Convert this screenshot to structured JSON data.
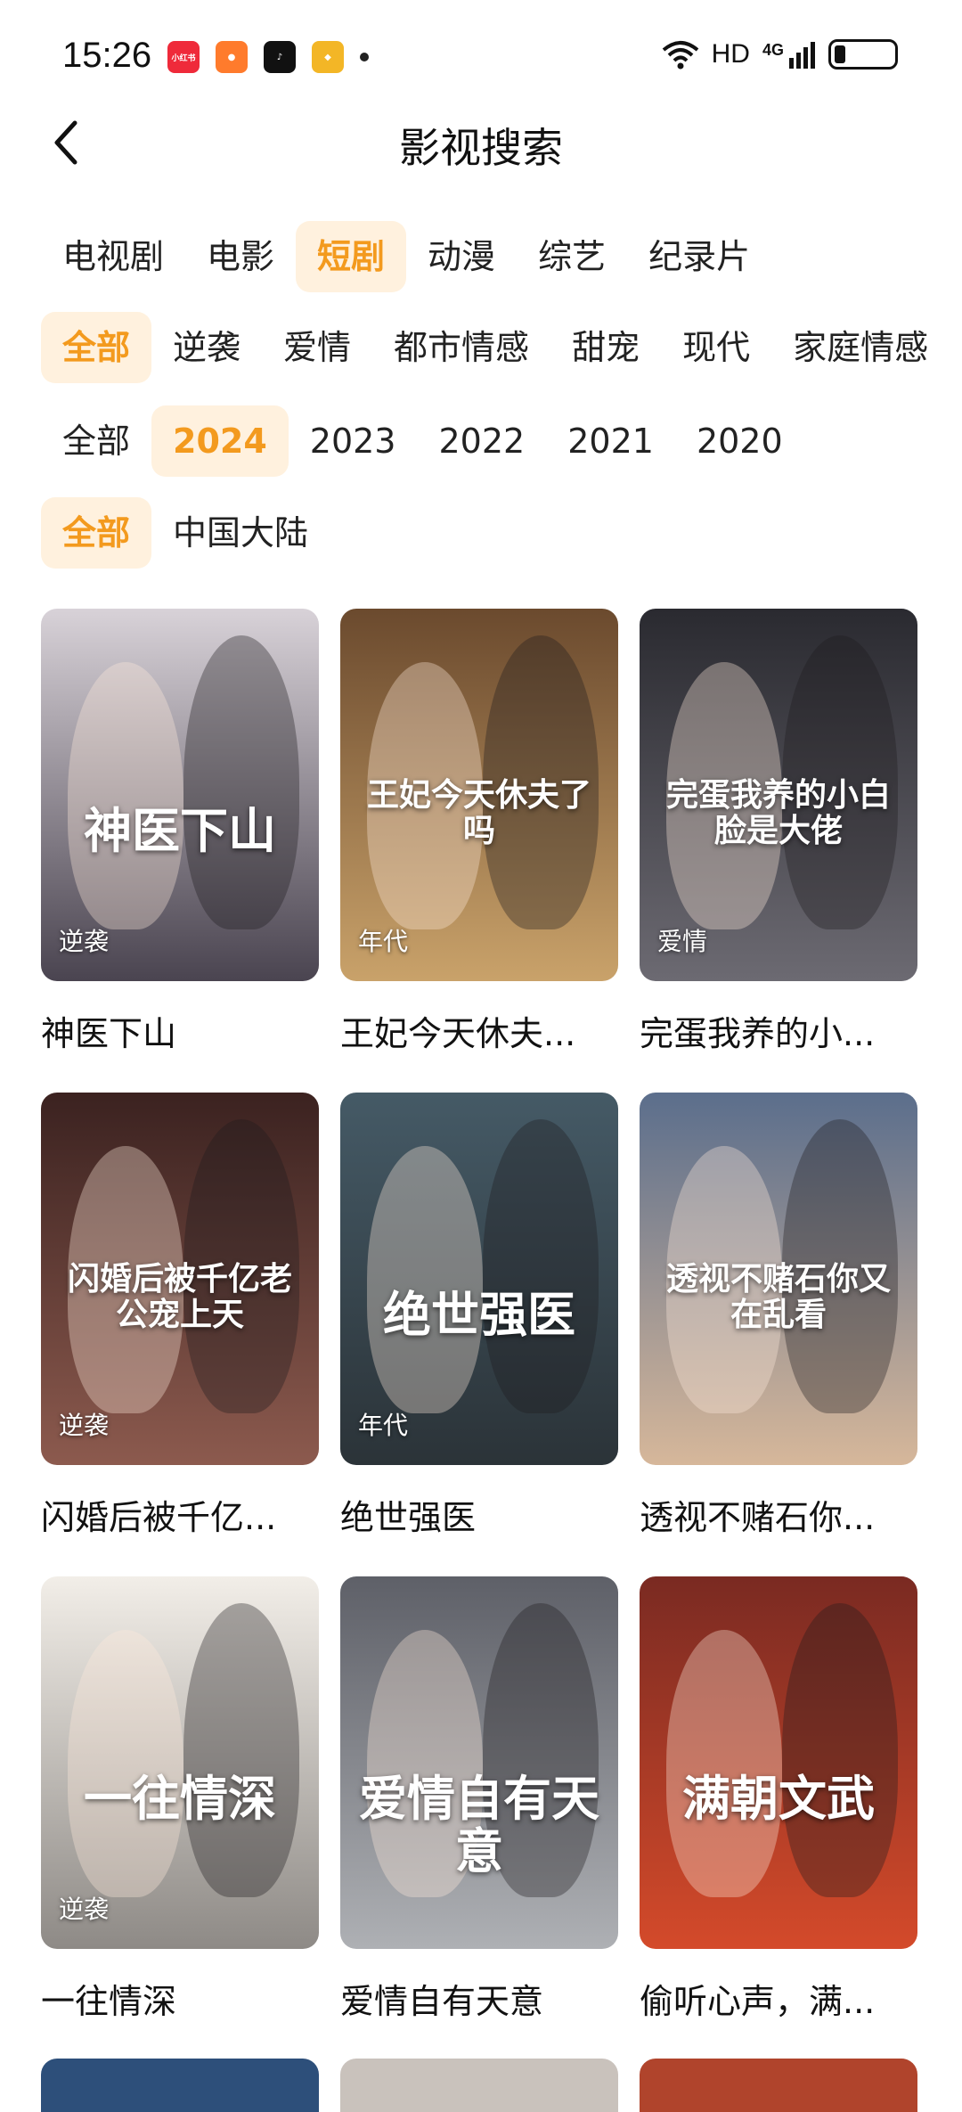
{
  "status_bar": {
    "time": "15:26",
    "notification_icons": [
      "xiaohongshu-icon",
      "app-icon",
      "tiktok-icon",
      "wallet-icon"
    ],
    "network": "HD",
    "signal": "4G"
  },
  "header": {
    "title": "影视搜索"
  },
  "filters": {
    "category": {
      "options": [
        "电视剧",
        "电影",
        "短剧",
        "动漫",
        "综艺",
        "纪录片"
      ],
      "selected": "短剧"
    },
    "genre": {
      "options": [
        "全部",
        "逆袭",
        "爱情",
        "都市情感",
        "甜宠",
        "现代",
        "家庭情感"
      ],
      "selected": "全部"
    },
    "year": {
      "options": [
        "全部",
        "2024",
        "2023",
        "2022",
        "2021",
        "2020"
      ],
      "selected": "2024"
    },
    "region": {
      "options": [
        "全部",
        "中国大陆"
      ],
      "selected": "全部"
    }
  },
  "results": [
    {
      "name": "神医下山",
      "tag": "逆袭",
      "poster_text": "神医下山",
      "color_top": "#d8d2d8",
      "color_bottom": "#4a4450"
    },
    {
      "name": "王妃今天休夫...",
      "tag": "年代",
      "poster_text": "王妃今天休夫了吗",
      "color_top": "#6b4a2e",
      "color_bottom": "#c9a26a"
    },
    {
      "name": "完蛋我养的小...",
      "tag": "爱情",
      "poster_text": "完蛋我养的小白脸是大佬",
      "color_top": "#2a2a30",
      "color_bottom": "#6c6a72"
    },
    {
      "name": "闪婚后被千亿...",
      "tag": "逆袭",
      "poster_text": "闪婚后被千亿老公宠上天",
      "color_top": "#3b2220",
      "color_bottom": "#8c5a4e"
    },
    {
      "name": "绝世强医",
      "tag": "年代",
      "poster_text": "绝世强医",
      "color_top": "#455a66",
      "color_bottom": "#2b3338"
    },
    {
      "name": "透视不赌石你...",
      "tag": "",
      "poster_text": "透视不赌石你又在乱看",
      "color_top": "#5b6e8c",
      "color_bottom": "#d6b79a"
    },
    {
      "name": "一往情深",
      "tag": "逆袭",
      "poster_text": "一往情深",
      "color_top": "#f2eee8",
      "color_bottom": "#8e8a86"
    },
    {
      "name": "爱情自有天意",
      "tag": "",
      "poster_text": "爱情自有天意",
      "color_top": "#5e6068",
      "color_bottom": "#aeb0b4"
    },
    {
      "name": "偷听心声，满...",
      "tag": "",
      "poster_text": "满朝文武",
      "color_top": "#7a2a22",
      "color_bottom": "#d44a2a"
    }
  ]
}
